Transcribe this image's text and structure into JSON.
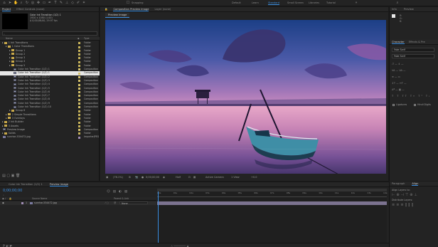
{
  "workspaces": [
    "Default",
    "Learn",
    "Standard",
    "Small Screen",
    "Libraries",
    "Tutorial"
  ],
  "snapping_label": "Snapping",
  "project": {
    "tabs": [
      "Project",
      "Effect Controls (none)"
    ],
    "selected_name": "Color Ink Transition (1/2) 1",
    "selected_info": [
      "1920 x 1080 (1.00)",
      "Δ 0;00;08;00, 29.97 fps"
    ],
    "columns": {
      "name": "Name",
      "type": "Type"
    },
    "items": [
      {
        "name": "1 Ink Transitions",
        "type": "Folder",
        "kind": "folder",
        "indent": 0,
        "color": "#c8b45a"
      },
      {
        "name": "1 Color Transitions",
        "type": "Folder",
        "kind": "folder",
        "indent": 1,
        "color": "#c8b45a"
      },
      {
        "name": "Group 1",
        "type": "Folder",
        "kind": "folder",
        "indent": 2,
        "color": "#c8b45a"
      },
      {
        "name": "Group 2",
        "type": "Folder",
        "kind": "folder",
        "indent": 2,
        "color": "#c8b45a"
      },
      {
        "name": "Group 3",
        "type": "Folder",
        "kind": "folder",
        "indent": 2,
        "color": "#c8b45a"
      },
      {
        "name": "Group 4",
        "type": "Folder",
        "kind": "folder",
        "indent": 2,
        "color": "#c8b45a"
      },
      {
        "name": "Group 5",
        "type": "Folder",
        "kind": "folder",
        "indent": 2,
        "color": "#c8b45a"
      },
      {
        "name": "Color Ink Transition (1/2) 1",
        "type": "Composition",
        "kind": "comp",
        "indent": 3,
        "color": "#d6c26a"
      },
      {
        "name": "Color Ink Transition (1/2) 1",
        "type": "Composition",
        "kind": "comp",
        "indent": 3,
        "color": "#d6c26a",
        "selected": true
      },
      {
        "name": "Color Ink Transition (1/2) 2",
        "type": "Composition",
        "kind": "comp",
        "indent": 3,
        "color": "#d6c26a"
      },
      {
        "name": "Color Ink Transition (1/2) 3",
        "type": "Composition",
        "kind": "comp",
        "indent": 3,
        "color": "#d6c26a"
      },
      {
        "name": "Color Ink Transition (1/2) 4",
        "type": "Composition",
        "kind": "comp",
        "indent": 3,
        "color": "#d6c26a"
      },
      {
        "name": "Color Ink Transition (1/2) 5",
        "type": "Composition",
        "kind": "comp",
        "indent": 3,
        "color": "#d6c26a"
      },
      {
        "name": "Color Ink Transition (1/2) 6",
        "type": "Composition",
        "kind": "comp",
        "indent": 3,
        "color": "#d6c26a"
      },
      {
        "name": "Color Ink Transition (1/2) 7",
        "type": "Composition",
        "kind": "comp",
        "indent": 3,
        "color": "#d6c26a"
      },
      {
        "name": "Color Ink Transition (1/2) 8",
        "type": "Composition",
        "kind": "comp",
        "indent": 3,
        "color": "#d6c26a"
      },
      {
        "name": "Color Ink Transition (1/2) 9",
        "type": "Composition",
        "kind": "comp",
        "indent": 3,
        "color": "#d6c26a"
      },
      {
        "name": "Color Ink Transition (1/2) 10",
        "type": "Composition",
        "kind": "comp",
        "indent": 3,
        "color": "#d6c26a"
      },
      {
        "name": "Group 6",
        "type": "Folder",
        "kind": "folder",
        "indent": 2,
        "color": "#c8b45a"
      },
      {
        "name": "2 Simple Transitions",
        "type": "Folder",
        "kind": "folder",
        "indent": 1,
        "color": "#c8b45a"
      },
      {
        "name": "3 Overlays",
        "type": "Folder",
        "kind": "folder",
        "indent": 1,
        "color": "#c8b45a"
      },
      {
        "name": "2 Ink Builder",
        "type": "Folder",
        "kind": "folder",
        "indent": 0,
        "color": "#c8b45a"
      },
      {
        "name": "3 Assets",
        "type": "Folder",
        "kind": "folder",
        "indent": 0,
        "color": "#c8b45a"
      },
      {
        "name": "Preview Image",
        "type": "Composition",
        "kind": "comp",
        "indent": 0,
        "color": "#d6c26a"
      },
      {
        "name": "Solids",
        "type": "Folder",
        "kind": "folder",
        "indent": 0,
        "color": "#c8b45a"
      },
      {
        "name": "sunrise-534472.jpg",
        "type": "ImporterJPEG",
        "kind": "img",
        "indent": 0,
        "color": "#a08cb4"
      }
    ]
  },
  "composition": {
    "tabs": [
      "Composition Preview Image",
      "Layer (none)"
    ],
    "sub_tab": "Preview Image",
    "bottom": {
      "zoom": "(76.1%)",
      "timecode": "0;00;00;00",
      "resolution": "Half",
      "camera": "Active Camera",
      "views": "1 View",
      "exposure": "+0.0"
    }
  },
  "right_panel": {
    "tabs": [
      "Info",
      "Preview"
    ],
    "char_tabs": [
      "Character",
      "Effects & Pre"
    ],
    "font": "Fake Serif",
    "style": "Fake Serif",
    "opts": [
      "Ligatures",
      "Hindi Digits"
    ]
  },
  "timeline": {
    "tabs": [
      "Color Ink Transition (1/2) 1",
      "Preview Image"
    ],
    "timecode": "0;00;00;00",
    "layer": {
      "index": "1",
      "name": "sunrise-534472.jpg",
      "parent": "None"
    },
    "col_source": "Source Name",
    "col_parent": "Parent & Link",
    "ruler": [
      "00s",
      "01s",
      "02s",
      "03s",
      "04s",
      "05s",
      "06s",
      "07s",
      "08s",
      "09s",
      "10s",
      "11s",
      "12s",
      "13s",
      "14s"
    ]
  },
  "paragraph": {
    "tabs": [
      "Paragraph",
      "Align"
    ],
    "align_layers_to": "Align Layers to:",
    "distribute": "Distribute Layers:"
  }
}
